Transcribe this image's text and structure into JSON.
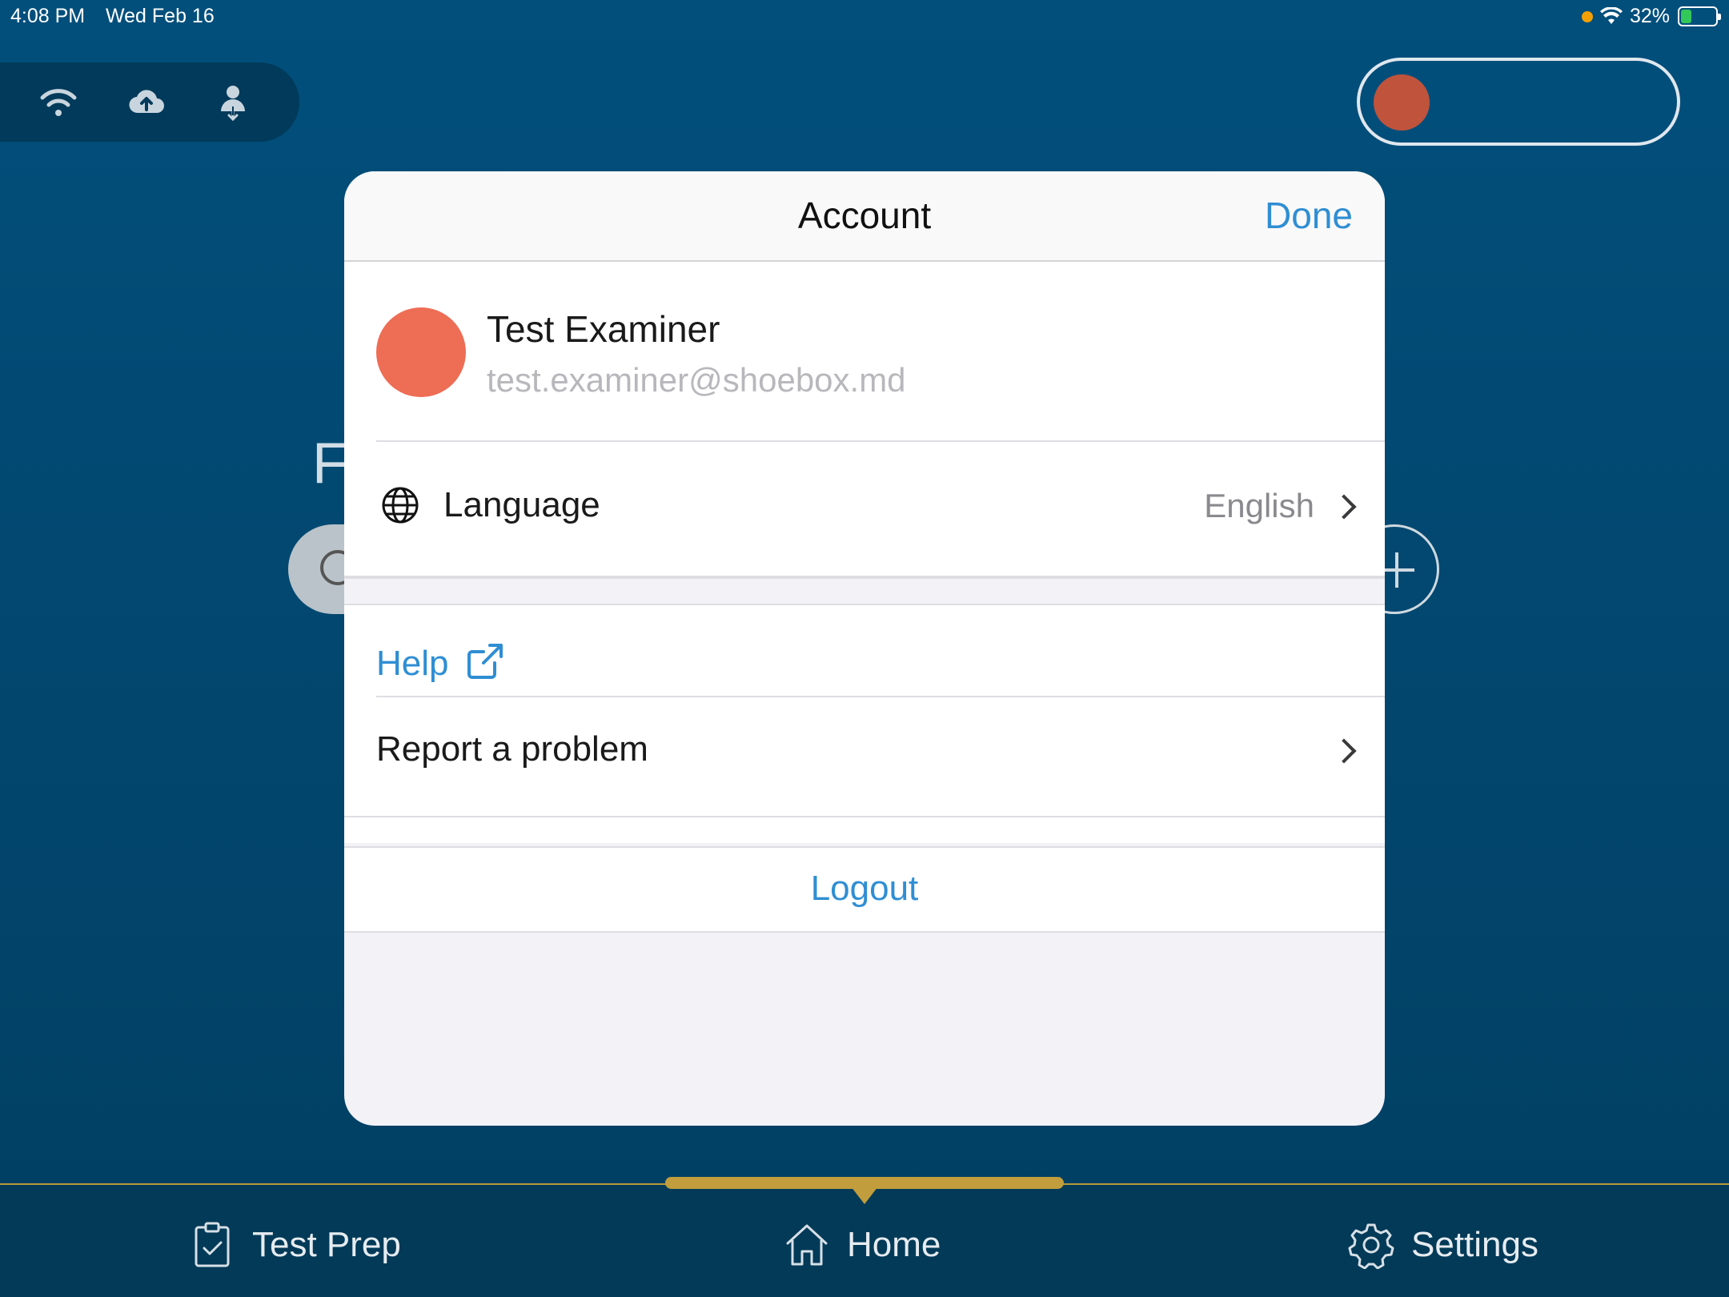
{
  "status_bar": {
    "time": "4:08 PM",
    "date": "Wed Feb 16",
    "battery": "32%",
    "battery_level": 0.32
  },
  "colors": {
    "accent": "#2f8ed3",
    "background": "#024f7c",
    "avatar": "#ee6d55",
    "tab_indicator": "#c19d3d"
  },
  "top_icons": [
    "wifi-icon",
    "cloud-upload-icon",
    "user-sync-icon"
  ],
  "background": {
    "partial_letter": "F"
  },
  "modal": {
    "title": "Account",
    "done_label": "Done",
    "profile": {
      "name": "Test Examiner",
      "email": "test.examiner@shoebox.md"
    },
    "language": {
      "label": "Language",
      "value": "English"
    },
    "help_label": "Help",
    "report_label": "Report a problem",
    "logout_label": "Logout"
  },
  "tabbar": {
    "tabs": [
      {
        "label": "Test Prep",
        "icon": "clipboard-check-icon"
      },
      {
        "label": "Home",
        "icon": "home-icon",
        "active": true
      },
      {
        "label": "Settings",
        "icon": "gear-icon"
      }
    ]
  }
}
